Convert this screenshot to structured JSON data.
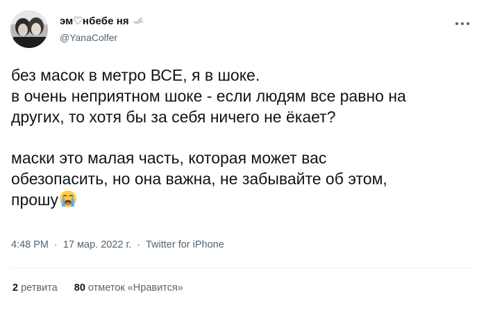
{
  "tweet": {
    "author": {
      "display_name": "эм♡нбебе ня",
      "handle": "@YanaColfer",
      "avatar_icon": "avatar-photo",
      "badge_icon": "dove-icon"
    },
    "more_icon": "more-dots-icon",
    "text_lines": [
      "без масок в метро ВСЕ, я в шоке.",
      "в очень неприятном шоке - если людям все равно на",
      "других, то хотя бы за себя ничего не ёкает?",
      "маски это малая часть, которая может вас",
      "обезопасить, но она важна, не забывайте об этом,",
      "прошу"
    ],
    "trailing_emoji": "😭",
    "time": "4:48 PM",
    "date": "17 мар. 2022 г.",
    "separator": "·",
    "source": "Twitter for iPhone",
    "stats": {
      "retweets_count": "2",
      "retweets_label": "ретвита",
      "likes_count": "80",
      "likes_label": "отметок «Нравится»"
    }
  },
  "colors": {
    "text_primary": "#0f1419",
    "text_secondary": "#536471",
    "divider": "#eff3f4",
    "background": "#ffffff"
  }
}
